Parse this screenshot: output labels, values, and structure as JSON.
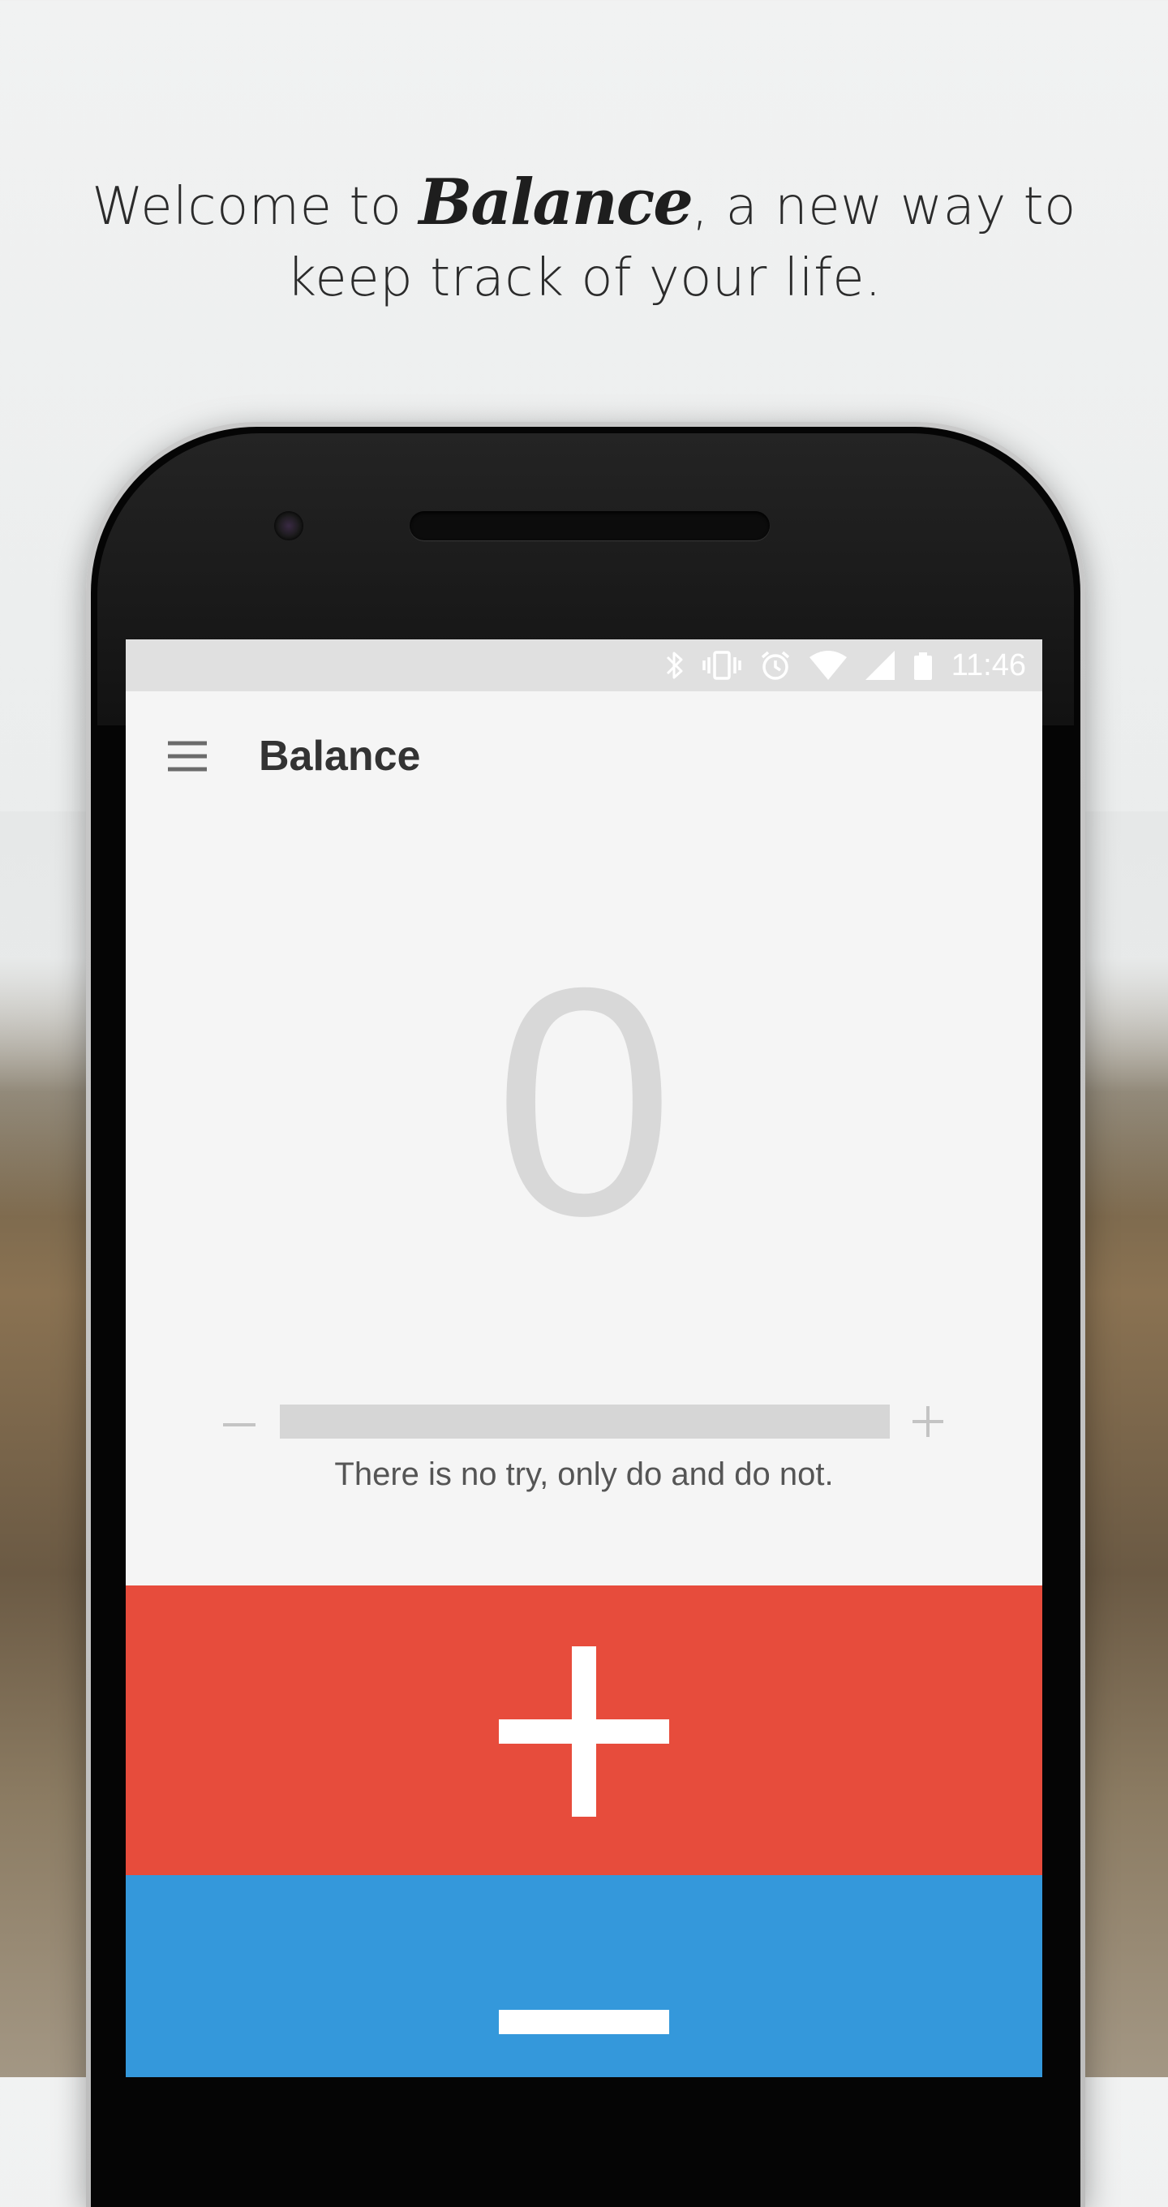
{
  "promo": {
    "headline_before": "Welcome to ",
    "headline_brand": "Balance",
    "headline_after": ", a new way to",
    "headline_line2": "keep track of your life."
  },
  "status_bar": {
    "time": "11:46",
    "icons": [
      "bluetooth-icon",
      "vibrate-icon",
      "alarm-icon",
      "wifi-icon",
      "cell-signal-icon",
      "battery-icon"
    ]
  },
  "app_bar": {
    "menu_icon": "hamburger-menu-icon",
    "title": "Balance"
  },
  "counter": {
    "value": "0"
  },
  "progress": {
    "fraction": 0,
    "decrease_icon": "minus-icon",
    "increase_icon": "plus-icon"
  },
  "quote": "There is no try, only do and do not.",
  "actions": {
    "increment_icon": "plus-icon",
    "decrement_icon": "minus-icon",
    "increment_color": "#e74c3c",
    "decrement_color": "#3498db"
  }
}
